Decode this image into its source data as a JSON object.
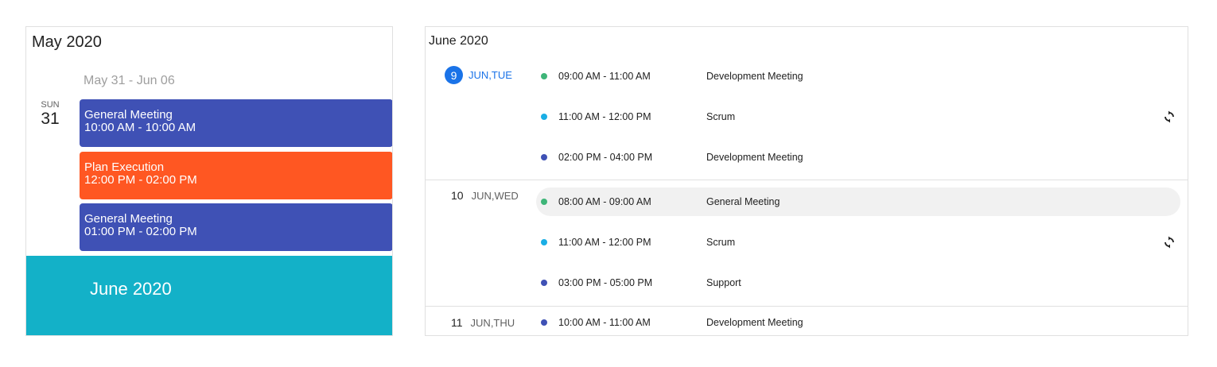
{
  "colors": {
    "indigo": "#3f51b5",
    "orange": "#ff5722",
    "teal": "#13b1c8",
    "green": "#3eb578",
    "sky": "#1aaee5",
    "blue_dot": "#3f51b5",
    "today_blue": "#1a73e8"
  },
  "schedule": {
    "month_title": "May 2020",
    "week_range": "May 31 - Jun 06",
    "day": {
      "name": "SUN",
      "number": "31"
    },
    "events": [
      {
        "title": "General Meeting",
        "time": "10:00 AM - 10:00 AM",
        "color": "#3f51b5"
      },
      {
        "title": "Plan Execution",
        "time": "12:00 PM - 02:00 PM",
        "color": "#ff5722"
      },
      {
        "title": "General Meeting",
        "time": "01:00 PM - 02:00 PM",
        "color": "#3f51b5"
      }
    ],
    "next_month_banner": "June 2020"
  },
  "agenda": {
    "month_title": "June 2020",
    "days": [
      {
        "number": "9",
        "label": "JUN,TUE",
        "today": true,
        "items": [
          {
            "time": "09:00 AM - 11:00 AM",
            "subject": "Development Meeting",
            "dot": "#3eb578",
            "recurring": false
          },
          {
            "time": "11:00 AM - 12:00 PM",
            "subject": "Scrum",
            "dot": "#1aaee5",
            "recurring": true,
            "icon": "recurrence-icon"
          },
          {
            "time": "02:00 PM - 04:00 PM",
            "subject": "Development Meeting",
            "dot": "#3f51b5",
            "recurring": false
          }
        ]
      },
      {
        "number": "10",
        "label": "JUN,WED",
        "today": false,
        "items": [
          {
            "time": "08:00 AM - 09:00 AM",
            "subject": "General Meeting",
            "dot": "#3eb578",
            "recurring": false,
            "hovered": true
          },
          {
            "time": "11:00 AM - 12:00 PM",
            "subject": "Scrum",
            "dot": "#1aaee5",
            "recurring": true,
            "icon": "recurrence-icon"
          },
          {
            "time": "03:00 PM - 05:00 PM",
            "subject": "Support",
            "dot": "#3f51b5",
            "recurring": false
          }
        ]
      },
      {
        "number": "11",
        "label": "JUN,THU",
        "today": false,
        "items": [
          {
            "time": "10:00 AM - 11:00 AM",
            "subject": "Development Meeting",
            "dot": "#3f51b5",
            "recurring": false
          }
        ]
      }
    ]
  }
}
